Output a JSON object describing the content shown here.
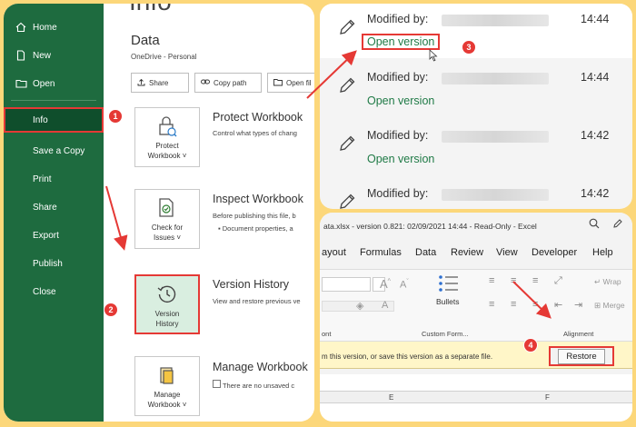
{
  "sidebar": {
    "items": [
      {
        "label": "Home",
        "icon": "home-icon"
      },
      {
        "label": "New",
        "icon": "new-file-icon"
      },
      {
        "label": "Open",
        "icon": "folder-icon"
      },
      {
        "label": "Info"
      },
      {
        "label": "Save a Copy"
      },
      {
        "label": "Print"
      },
      {
        "label": "Share"
      },
      {
        "label": "Export"
      },
      {
        "label": "Publish"
      },
      {
        "label": "Close"
      }
    ]
  },
  "main": {
    "info_title": "Info",
    "data_title": "Data",
    "data_sub": "OneDrive - Personal",
    "buttons": {
      "share": "Share",
      "copy_path": "Copy path",
      "open_file": "Open fil"
    },
    "protect": {
      "box_line1": "Protect",
      "box_line2": "Workbook ˅",
      "title": "Protect Workbook",
      "desc": "Control what types of chang"
    },
    "inspect": {
      "box_line1": "Check for",
      "box_line2": "Issues ˅",
      "title": "Inspect Workbook",
      "desc1": "Before publishing this file, b",
      "desc2": "Document properties, a"
    },
    "version": {
      "box_line1": "Version",
      "box_line2": "History",
      "title": "Version History",
      "desc": "View and restore previous ve"
    },
    "manage": {
      "box_line1": "Manage",
      "box_line2": "Workbook ˅",
      "title": "Manage Workbook",
      "desc": "There are no unsaved c"
    }
  },
  "versions": [
    {
      "modified": "Modified by:",
      "time": "14:44",
      "open": "Open version"
    },
    {
      "modified": "Modified by:",
      "time": "14:44",
      "open": "Open version"
    },
    {
      "modified": "Modified by:",
      "time": "14:42",
      "open": "Open version"
    },
    {
      "modified": "Modified by:",
      "time": "14:42",
      "open": ""
    }
  ],
  "excel": {
    "title": "ata.xlsx  -  version 0.821: 02/09/2021 14:44  -  Read-Only  -  Excel",
    "tabs": [
      "ayout",
      "Formulas",
      "Data",
      "Review",
      "View",
      "Developer",
      "Help"
    ],
    "bullets_label": "Bullets",
    "wrap_label": "Wrap",
    "merge_label": "Merge",
    "font_group": "ont",
    "custom_group": "Custom Form...",
    "alignment_group": "Alignment",
    "info_text": "m this version, or save this version as a separate file.",
    "restore_label": "Restore",
    "columns": [
      "E",
      "F"
    ]
  },
  "badges": [
    "1",
    "2",
    "3",
    "4"
  ],
  "colors": {
    "excel_green": "#1e6b3f",
    "highlight_red": "#e53935",
    "open_version_green": "#1f7a46",
    "frame_yellow": "#fcd77a"
  }
}
